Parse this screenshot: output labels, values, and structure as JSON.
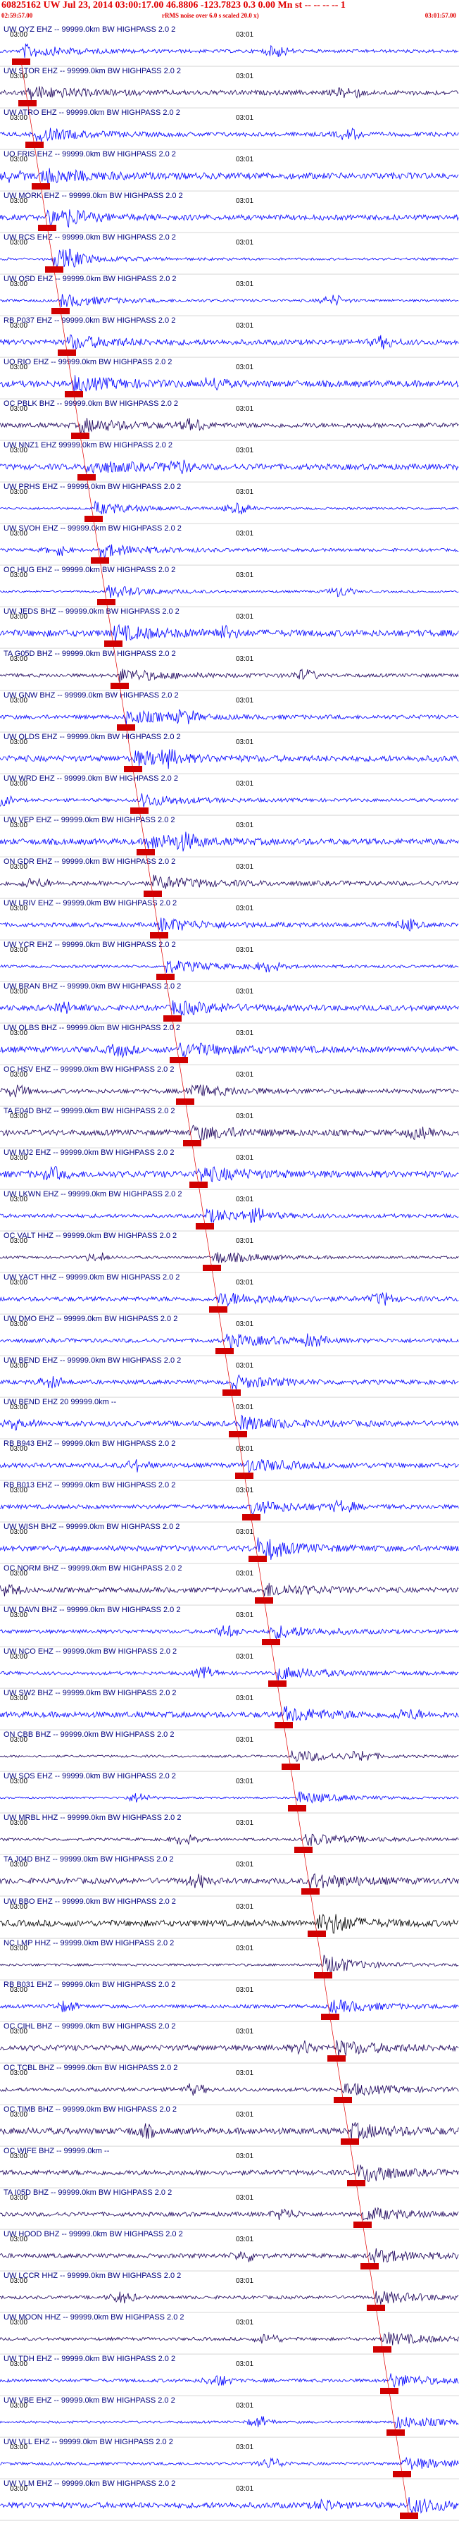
{
  "header": {
    "title": "60825162 UW Jul 23, 2014 03:00:17.00   46.8806 -123.7823  0.3 0.00 Mn st -- -- -- -- 1",
    "left_time": "02:59:57.00",
    "center_note": "rRMS noise over 6.0 s scaled 20.0 x)",
    "right_time": "03:01:57.00"
  },
  "time_labels": {
    "start": "03:00",
    "end": "03:01"
  },
  "colors": {
    "blue": "#0000ff",
    "dark": "#1a005a",
    "black": "#000000",
    "red": "#d00000",
    "label": "#000080"
  },
  "traces": [
    {
      "label": "UW OYZ EHZ -- 99999.0km BW  HIGHPASS  2.0  2",
      "color": "blue"
    },
    {
      "label": "UW STOR EHZ -- 99999.0km BW  HIGHPASS  2.0  2",
      "color": "dark"
    },
    {
      "label": "UW ATRO EHZ -- 99999.0km BW  HIGHPASS  2.0  2",
      "color": "blue"
    },
    {
      "label": "UO FRIS EHZ -- 99999.0km BW  HIGHPASS  2.0  2",
      "color": "blue"
    },
    {
      "label": "UW MORK EHZ -- 99999.0km BW  HIGHPASS  2.0  2",
      "color": "blue"
    },
    {
      "label": "UW RCS EHZ -- 99999.0km BW  HIGHPASS  2.0  2",
      "color": "blue"
    },
    {
      "label": "UW OSD EHZ -- 99999.0km BW  HIGHPASS  2.0  2",
      "color": "blue"
    },
    {
      "label": "RB P037 EHZ -- 99999.0km BW  HIGHPASS  2.0  2",
      "color": "blue"
    },
    {
      "label": "UO RIO EHZ -- 99999.0km BW  HIGHPASS  2.0  2",
      "color": "blue"
    },
    {
      "label": "OC PBLK BHZ -- 99999.0km BW  HIGHPASS  2.0  2",
      "color": "dark"
    },
    {
      "label": "UW NNZ1 EHZ 99999.0km BW  HIGHPASS  2.0  2",
      "color": "blue"
    },
    {
      "label": "UW PRHS EHZ -- 99999.0km BW  HIGHPASS  2.0  2",
      "color": "blue"
    },
    {
      "label": "UW SVOH EHZ -- 99999.0km BW  HIGHPASS  2.0  2",
      "color": "blue"
    },
    {
      "label": "OC HUG EHZ -- 99999.0km BW  HIGHPASS  2.0  2",
      "color": "blue"
    },
    {
      "label": "UW JEDS BHZ -- 99999.0km BW  HIGHPASS  2.0  2",
      "color": "blue"
    },
    {
      "label": "TA G05D BHZ -- 99999.0km BW  HIGHPASS  2.0  2",
      "color": "dark"
    },
    {
      "label": "UW GNW BHZ -- 99999.0km BW  HIGHPASS  2.0  2",
      "color": "blue"
    },
    {
      "label": "UW OLDS EHZ -- 99999.0km BW  HIGHPASS  2.0  2",
      "color": "blue"
    },
    {
      "label": "UW WRD EHZ -- 99999.0km BW  HIGHPASS  2.0  2",
      "color": "blue"
    },
    {
      "label": "UW VEP EHZ -- 99999.0km BW  HIGHPASS  2.0  2",
      "color": "blue"
    },
    {
      "label": "ON GDR EHZ -- 99999.0km BW  HIGHPASS  2.0  2",
      "color": "dark"
    },
    {
      "label": "UW LRIV EHZ -- 99999.0km BW  HIGHPASS  2.0  2",
      "color": "blue"
    },
    {
      "label": "UW YCR EHZ -- 99999.0km BW  HIGHPASS  2.0  2",
      "color": "blue"
    },
    {
      "label": "UW BRAN BHZ -- 99999.0km BW  HIGHPASS  2.0  2",
      "color": "blue"
    },
    {
      "label": "UW OLBS BHZ -- 99999.0km BW  HIGHPASS  2.0  2",
      "color": "blue"
    },
    {
      "label": "OC HSV EHZ -- 99999.0km BW  HIGHPASS  2.0  2",
      "color": "dark"
    },
    {
      "label": "TA E04D BHZ -- 99999.0km BW  HIGHPASS  2.0  2",
      "color": "dark"
    },
    {
      "label": "UW MJ2 EHZ -- 99999.0km BW  HIGHPASS  2.0  2",
      "color": "blue"
    },
    {
      "label": "UW LKWN EHZ -- 99999.0km BW  HIGHPASS  2.0  2",
      "color": "blue"
    },
    {
      "label": "OC VALT HHZ -- 99999.0km BW  HIGHPASS  2.0  2",
      "color": "dark"
    },
    {
      "label": "UW YACT HHZ -- 99999.0km BW  HIGHPASS  2.0  2",
      "color": "blue"
    },
    {
      "label": "UW DMO EHZ -- 99999.0km BW  HIGHPASS  2.0  2",
      "color": "blue"
    },
    {
      "label": "UW BEND EHZ -- 99999.0km BW  HIGHPASS  2.0  2",
      "color": "blue"
    },
    {
      "label": "UW BEND EHZ 20 99999.0km --",
      "color": "blue"
    },
    {
      "label": "RB B943 EHZ -- 99999.0km BW  HIGHPASS  2.0  2",
      "color": "blue"
    },
    {
      "label": "RB B013 EHZ -- 99999.0km BW  HIGHPASS  2.0  2",
      "color": "blue"
    },
    {
      "label": "UW WISH BHZ -- 99999.0km BW  HIGHPASS  2.0  2",
      "color": "blue"
    },
    {
      "label": "OC NORM BHZ -- 99999.0km BW  HIGHPASS  2.0  2",
      "color": "dark"
    },
    {
      "label": "UW DAVN BHZ -- 99999.0km BW  HIGHPASS  2.0  2",
      "color": "blue"
    },
    {
      "label": "UW NCO EHZ -- 99999.0km BW  HIGHPASS  2.0  2",
      "color": "blue"
    },
    {
      "label": "UW SW2 BHZ -- 99999.0km BW  HIGHPASS  2.0  2",
      "color": "blue"
    },
    {
      "label": "ON CBB BHZ -- 99999.0km BW  HIGHPASS  2.0  2",
      "color": "dark"
    },
    {
      "label": "UW SOS EHZ -- 99999.0km BW  HIGHPASS  2.0  2",
      "color": "blue"
    },
    {
      "label": "UW MRBL HHZ -- 99999.0km BW  HIGHPASS  2.0  2",
      "color": "dark"
    },
    {
      "label": "TA J04D BHZ -- 99999.0km BW  HIGHPASS  2.0  2",
      "color": "dark"
    },
    {
      "label": "UW BBO EHZ -- 99999.0km BW  HIGHPASS  2.0  2",
      "color": "black"
    },
    {
      "label": "NC LMP HHZ -- 99999.0km BW  HIGHPASS  2.0  2",
      "color": "dark"
    },
    {
      "label": "RB B031 EHZ -- 99999.0km BW  HIGHPASS  2.0  2",
      "color": "blue"
    },
    {
      "label": "OC CIHL BHZ -- 99999.0km BW  HIGHPASS  2.0  2",
      "color": "dark"
    },
    {
      "label": "OC TCBL BHZ -- 99999.0km BW  HIGHPASS  2.0  2",
      "color": "dark"
    },
    {
      "label": "OC TIMB BHZ -- 99999.0km BW  HIGHPASS  2.0  2",
      "color": "dark"
    },
    {
      "label": "OC WIFE BHZ -- 99999.0km --",
      "color": "dark"
    },
    {
      "label": "TA I05D BHZ -- 99999.0km BW  HIGHPASS  2.0  2",
      "color": "dark"
    },
    {
      "label": "UW HOOD BHZ -- 99999.0km BW  HIGHPASS  2.0  2",
      "color": "dark"
    },
    {
      "label": "UW LCCR HHZ -- 99999.0km BW  HIGHPASS  2.0  2",
      "color": "dark"
    },
    {
      "label": "UW MOON HHZ -- 99999.0km BW  HIGHPASS  2.0  2",
      "color": "dark"
    },
    {
      "label": "UW TDH EHZ -- 99999.0km BW  HIGHPASS  2.0  2",
      "color": "blue"
    },
    {
      "label": "UW VBE EHZ -- 99999.0km BW  HIGHPASS  2.0  2",
      "color": "blue"
    },
    {
      "label": "UW VLL EHZ -- 99999.0km BW  HIGHPASS  2.0  2",
      "color": "blue"
    },
    {
      "label": "UW VLM EHZ -- 99999.0km BW  HIGHPASS  2.0  2",
      "color": "blue"
    }
  ]
}
